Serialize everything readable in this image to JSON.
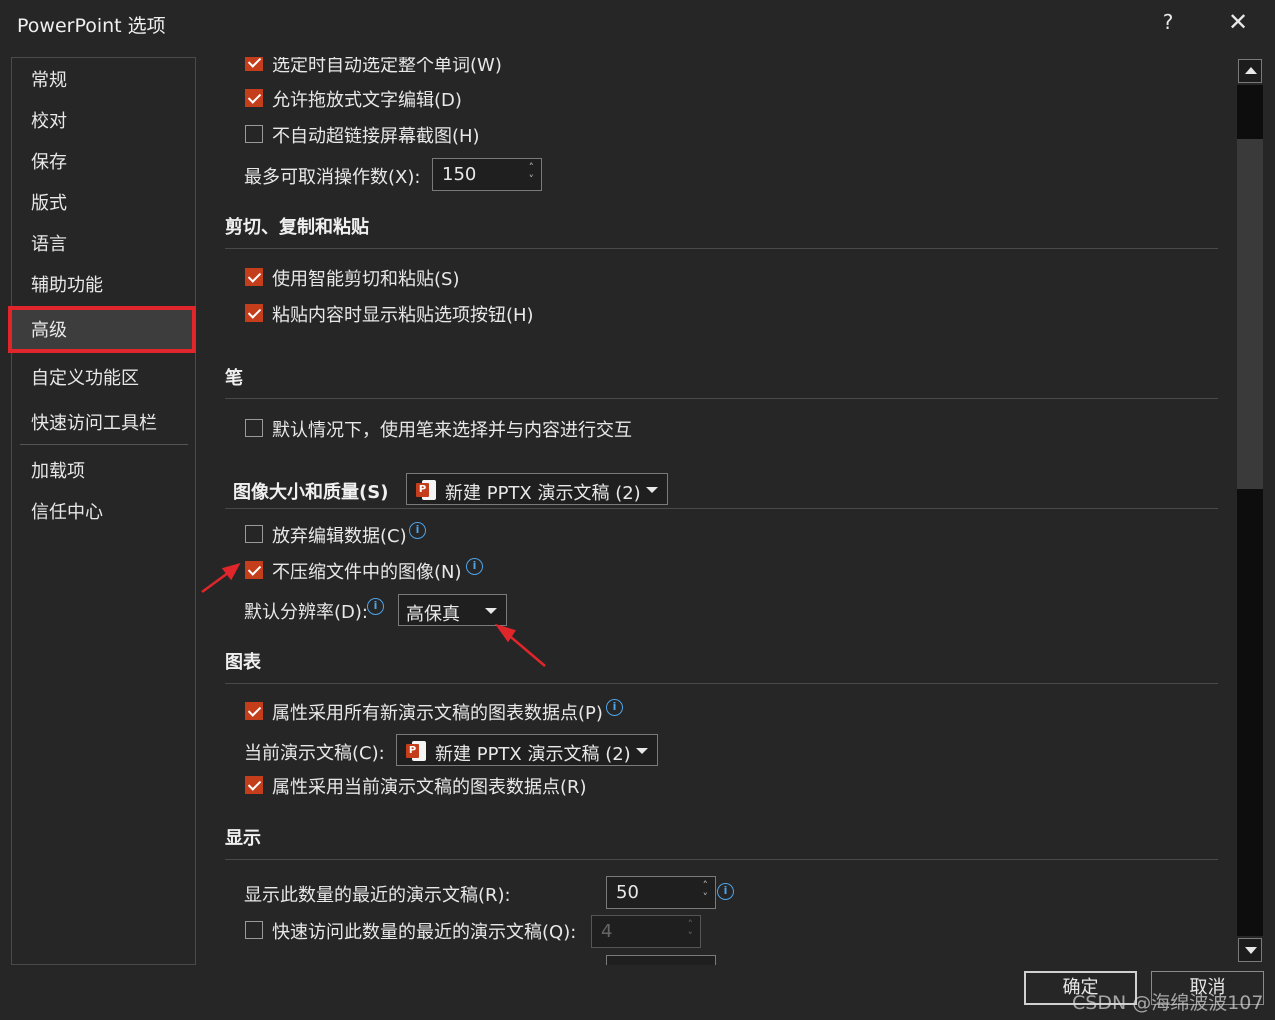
{
  "window": {
    "title": "PowerPoint 选项",
    "help": "?",
    "close": "✕"
  },
  "sidebar": {
    "items": [
      {
        "label": "常规"
      },
      {
        "label": "校对"
      },
      {
        "label": "保存"
      },
      {
        "label": "版式"
      },
      {
        "label": "语言"
      },
      {
        "label": "辅助功能"
      },
      {
        "label": "高级"
      },
      {
        "label": "自定义功能区"
      },
      {
        "label": "快速访问工具栏"
      },
      {
        "label": "加载项"
      },
      {
        "label": "信任中心"
      }
    ],
    "selected": "高级"
  },
  "editing": {
    "select_whole_word": "选定时自动选定整个单词(W)",
    "allow_drag_drop": "允许拖放式文字编辑(D)",
    "no_autolink_screenshot": "不自动超链接屏幕截图(H)",
    "max_undo_label": "最多可取消操作数(X):",
    "max_undo_value": "150"
  },
  "cut_copy_paste": {
    "title": "剪切、复制和粘贴",
    "smart_cut_paste": "使用智能剪切和粘贴(S)",
    "show_paste_options": "粘贴内容时显示粘贴选项按钮(H)"
  },
  "pen": {
    "title": "笔",
    "use_pen_default": "默认情况下，使用笔来选择并与内容进行交互"
  },
  "image_quality": {
    "title": "图像大小和质量(S)",
    "file": "新建 PPTX 演示文稿 (2)",
    "discard_edit_data": "放弃编辑数据(C)",
    "no_compress_images": "不压缩文件中的图像(N)",
    "default_resolution_label": "默认分辨率(D):",
    "default_resolution_value": "高保真"
  },
  "chart": {
    "title": "图表",
    "props_all_new": "属性采用所有新演示文稿的图表数据点(P)",
    "current_label": "当前演示文稿(C):",
    "current_file": "新建 PPTX 演示文稿 (2)",
    "props_current": "属性采用当前演示文稿的图表数据点(R)"
  },
  "display": {
    "title": "显示",
    "recent_count_label": "显示此数量的最近的演示文稿(R):",
    "recent_count_value": "50",
    "quick_access_label": "快速访问此数量的最近的演示文稿(Q):",
    "quick_access_value": "4"
  },
  "buttons": {
    "ok": "确定",
    "cancel": "取消"
  },
  "watermark": "CSDN @海绵波波107",
  "icons": {
    "info": "i",
    "ppt_letter": "P"
  },
  "colors": {
    "accent": "#c43e1c",
    "highlight": "#e0262b",
    "info": "#4ea3e8"
  }
}
